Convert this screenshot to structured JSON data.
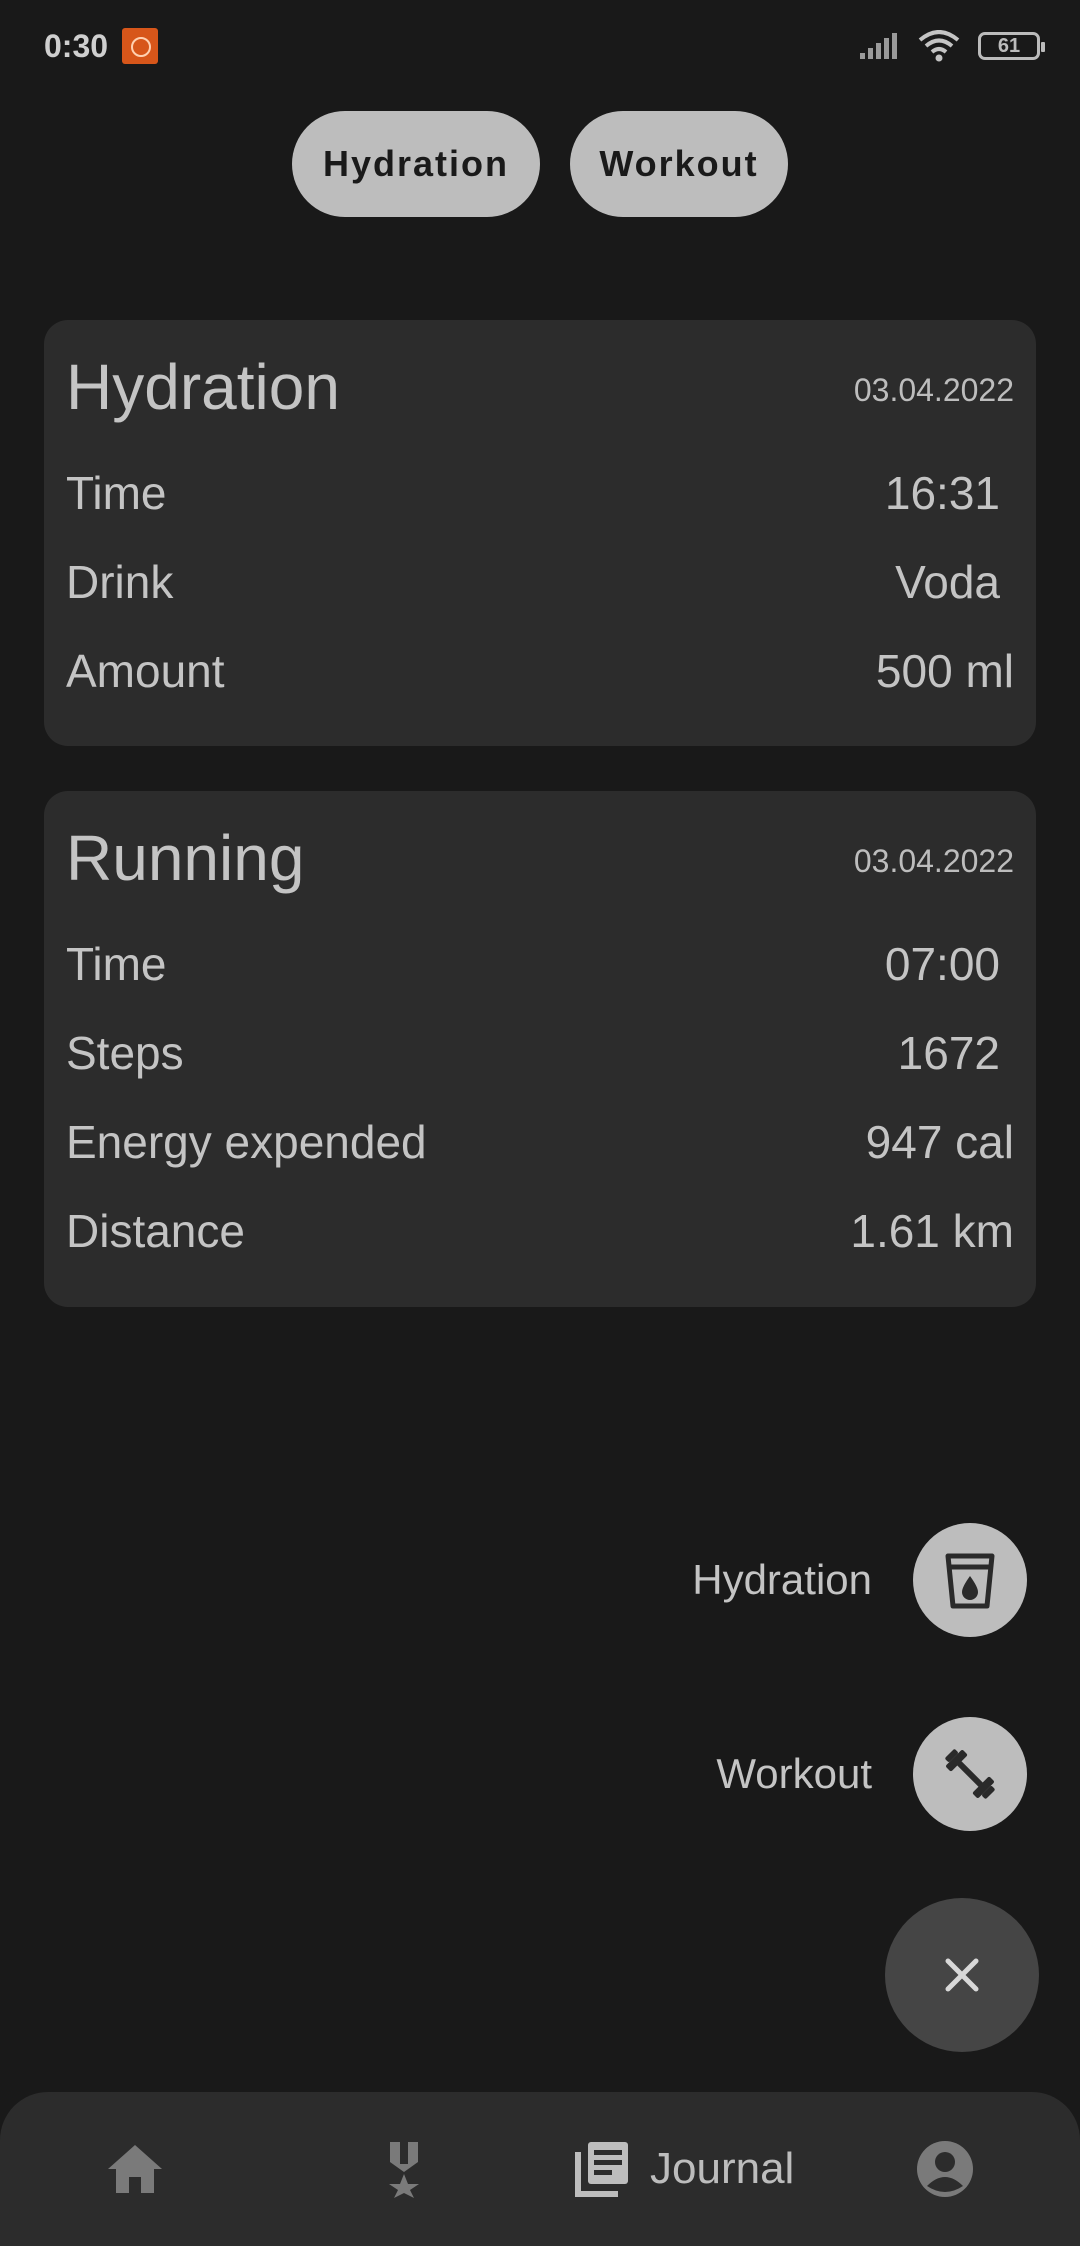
{
  "status_bar": {
    "time": "0:30",
    "battery": "61"
  },
  "filters": [
    {
      "label": "Hydration"
    },
    {
      "label": "Workout"
    }
  ],
  "hydration_card": {
    "title": "Hydration",
    "date": "03.04.2022",
    "rows": [
      {
        "label": "Time",
        "value": "16:31"
      },
      {
        "label": "Drink",
        "value": "Voda"
      },
      {
        "label": "Amount",
        "value": "500 ml"
      }
    ]
  },
  "running_card": {
    "title": "Running",
    "date": "03.04.2022",
    "rows": [
      {
        "label": "Time",
        "value": "07:00"
      },
      {
        "label": "Steps",
        "value": "1672"
      },
      {
        "label": "Energy expended",
        "value": "947 cal"
      },
      {
        "label": "Distance",
        "value": "1.61 km"
      }
    ]
  },
  "speed_dial": {
    "hydration_label": "Hydration",
    "workout_label": "Workout",
    "hydration_icon": "water-glass-icon",
    "workout_icon": "dumbbell-icon",
    "close_icon": "close-icon"
  },
  "bottom_nav": {
    "active_label": "Journal",
    "items": [
      "home-icon",
      "medal-icon",
      "journal-icon",
      "account-icon"
    ]
  },
  "colors": {
    "background": "#191919",
    "card": "#2c2c2c",
    "chip": "#bdbdbd",
    "text": "#c4c4c4"
  }
}
